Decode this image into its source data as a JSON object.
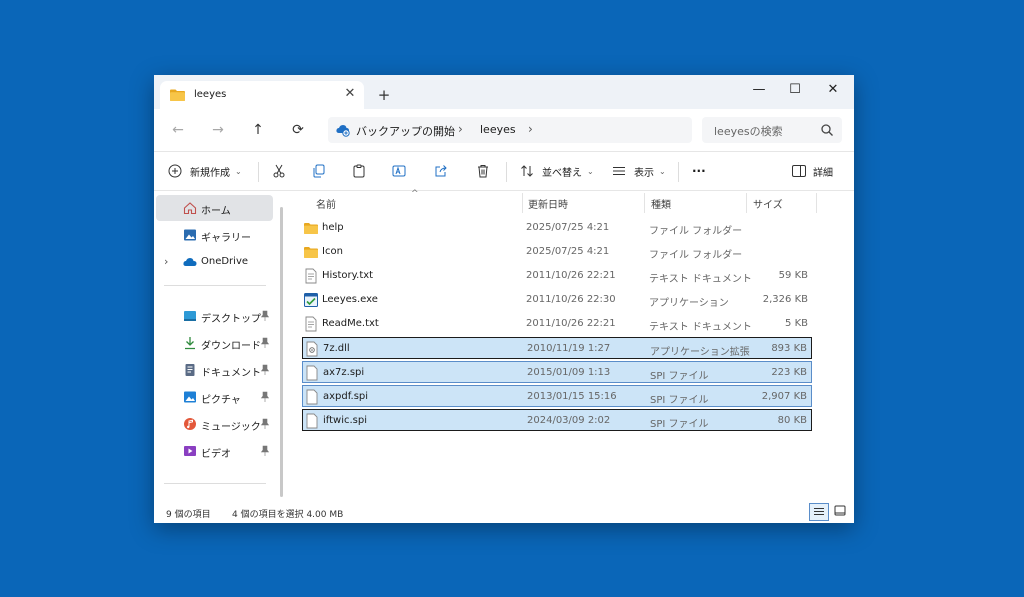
{
  "window": {
    "tab_title": "leeyes",
    "tab_close": "✕",
    "new_tab": "+",
    "controls": {
      "minimize": "—",
      "maximize": "☐",
      "close": "✕"
    }
  },
  "nav": {
    "back": "←",
    "forward": "→",
    "up": "↑",
    "refresh": "⟳",
    "breadcrumb": [
      "バックアップの開始",
      "leeyes"
    ],
    "crumb_sep": "›",
    "search_placeholder": "leeyesの検索"
  },
  "toolbar": {
    "new_label": "新規作成",
    "sort_label": "並べ替え",
    "view_label": "表示",
    "more_label": "···",
    "details_label": "詳細"
  },
  "sidebar": {
    "items": [
      {
        "label": "ホーム",
        "icon": "home-icon"
      },
      {
        "label": "ギャラリー",
        "icon": "gallery-icon"
      },
      {
        "label": "OneDrive",
        "icon": "onedrive-icon"
      },
      {
        "label": "デスクトップ",
        "icon": "desktop-icon"
      },
      {
        "label": "ダウンロード",
        "icon": "download-icon"
      },
      {
        "label": "ドキュメント",
        "icon": "documents-icon"
      },
      {
        "label": "ピクチャ",
        "icon": "pictures-icon"
      },
      {
        "label": "ミュージック",
        "icon": "music-icon"
      },
      {
        "label": "ビデオ",
        "icon": "video-icon"
      }
    ],
    "expand_glyph": "›"
  },
  "columns": {
    "name": "名前",
    "date": "更新日時",
    "type": "種類",
    "size": "サイズ",
    "sort_caret": "^"
  },
  "files": [
    {
      "name": "help",
      "date": "2025/07/25 4:21",
      "type": "ファイル フォルダー",
      "size": "",
      "icon": "folder-icon"
    },
    {
      "name": "Icon",
      "date": "2025/07/25 4:21",
      "type": "ファイル フォルダー",
      "size": "",
      "icon": "folder-icon"
    },
    {
      "name": "History.txt",
      "date": "2011/10/26 22:21",
      "type": "テキスト ドキュメント",
      "size": "59 KB",
      "icon": "text-file-icon"
    },
    {
      "name": "Leeyes.exe",
      "date": "2011/10/26 22:30",
      "type": "アプリケーション",
      "size": "2,326 KB",
      "icon": "app-icon"
    },
    {
      "name": "ReadMe.txt",
      "date": "2011/10/26 22:21",
      "type": "テキスト ドキュメント",
      "size": "5 KB",
      "icon": "text-file-icon"
    },
    {
      "name": "7z.dll",
      "date": "2010/11/19 1:27",
      "type": "アプリケーション拡張",
      "size": "893 KB",
      "icon": "dll-icon"
    },
    {
      "name": "ax7z.spi",
      "date": "2015/01/09 1:13",
      "type": "SPI ファイル",
      "size": "223 KB",
      "icon": "file-icon"
    },
    {
      "name": "axpdf.spi",
      "date": "2013/01/15 15:16",
      "type": "SPI ファイル",
      "size": "2,907 KB",
      "icon": "file-icon"
    },
    {
      "name": "iftwic.spi",
      "date": "2024/03/09 2:02",
      "type": "SPI ファイル",
      "size": "80 KB",
      "icon": "file-icon"
    }
  ],
  "status": {
    "count": "9 個の項目",
    "selection": "4 個の項目を選択 4.00 MB"
  },
  "colors": {
    "accent": "#0a66b8",
    "selection": "#cce4f7",
    "selection_border": "#5a8dc9",
    "folder": "#f3c14b"
  }
}
